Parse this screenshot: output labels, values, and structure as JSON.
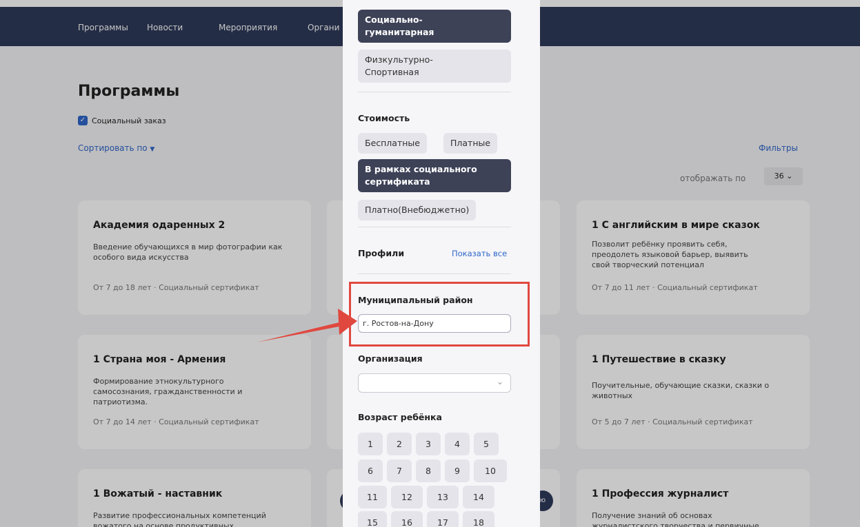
{
  "nav": {
    "items": [
      "Программы",
      "Новости",
      "Мероприятия",
      "Органи"
    ]
  },
  "main": {
    "title": "Программы",
    "checkbox_label": "Социальный заказ",
    "checkbox_checked": true,
    "sort_label": "Сортировать по",
    "filters_label": "Фильтры",
    "per_page_label": "отображать по",
    "per_page_value": "36"
  },
  "cards": [
    {
      "title": "Академия одаренных 2",
      "desc": "Введение обучающихся в мир фотографии как особого вида искусства",
      "meta": "От 7 до 18 лет · Социальный сертификат"
    },
    {
      "title": "1 С английским в мире сказок",
      "desc": "Позволит ребёнку проявить себя, преодолеть языковой барьер, выявить свой творческий потенциал",
      "meta": "От 7 до 11 лет · Социальный сертификат"
    },
    {
      "title": "1 Страна моя - Армения",
      "desc": "Формирование этнокультурного самосознания, гражданственности и патриотизма.",
      "meta": "От 7 до 14 лет · Социальный сертификат"
    },
    {
      "title": "1 Путешествие в сказку",
      "desc": "Поучительные, обучающие сказки, сказки о животных",
      "meta": "От 5 до 7 лет · Социальный сертификат"
    },
    {
      "title": "1 Вожатый - наставник",
      "desc": "Развитие профессиональных компетенций вожатого на основе продуктивных",
      "meta": ""
    },
    {
      "title": "1 Профессия журналист",
      "desc": "Получение знаний об основах журналистского творчества и первичные",
      "meta": ""
    }
  ],
  "filters": {
    "directions": [
      "Социально-\nгуманитарная",
      "Физкультурно-\nСпортивная"
    ],
    "cost_title": "Стоимость",
    "cost_options": [
      "Бесплатные",
      "Платные",
      "В рамках социального\nсертификата",
      "Платно(Внебюджетно)"
    ],
    "profiles_title": "Профили",
    "show_all": "Показать все",
    "district_title": "Муниципальный район",
    "district_value": "г. Ростов-на-Дону",
    "org_title": "Организация",
    "org_value": "",
    "age_title": "Возраст ребёнка",
    "ages": [
      "1",
      "2",
      "3",
      "4",
      "5",
      "6",
      "7",
      "8",
      "9",
      "10",
      "11",
      "12",
      "13",
      "14",
      "15",
      "16",
      "17",
      "18"
    ]
  },
  "side_button_text": "ю",
  "colors": {
    "navbar": "#2f3a5a",
    "accent": "#2f66c8",
    "active_chip": "#3d4257",
    "highlight": "#e0483f"
  }
}
